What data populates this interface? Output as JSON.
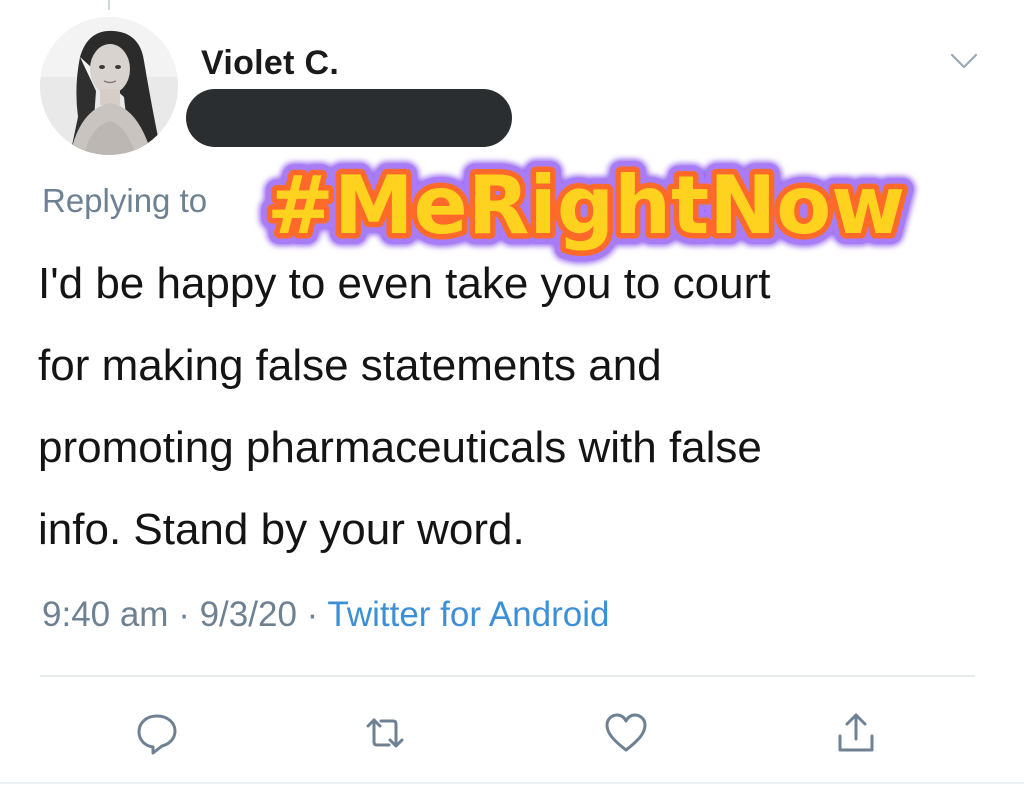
{
  "tweet": {
    "author": {
      "display_name": "Violet C.",
      "avatar_icon": "profile-photo"
    },
    "replying_to_label": "Replying to",
    "overlay_sticker_text": "#MeRightNow",
    "body": "I'd be happy to even take you to court\nfor making false statements and\npromoting pharmaceuticals with false\ninfo. Stand by your word.",
    "meta": {
      "time": "9:40 am",
      "separator": "·",
      "date": "9/3/20",
      "source": "Twitter for Android"
    },
    "actions": {
      "reply_icon": "comment-icon",
      "retweet_icon": "retweet-icon",
      "like_icon": "heart-icon",
      "share_icon": "share-icon"
    },
    "colors": {
      "muted_text": "#6e8193",
      "link": "#3d8fd6",
      "sticker_fill": "#ffd21f",
      "sticker_outline": "#ff6a2b",
      "sticker_glow": "#9b6cf0",
      "redaction": "#2a2e31"
    }
  }
}
